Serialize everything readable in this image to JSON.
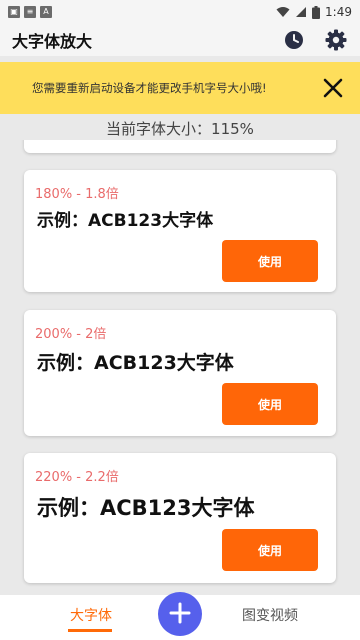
{
  "status_bar": {
    "time": "1:49",
    "left_icons": [
      "image-notification-icon",
      "news-notification-icon",
      "font-a-notification-icon"
    ],
    "right_icons": [
      "wifi-icon",
      "signal-icon",
      "battery-icon"
    ]
  },
  "app_bar": {
    "title": "大字体放大",
    "actions": [
      "history-icon",
      "settings-icon"
    ]
  },
  "notice": {
    "text": "您需要重新启动设备才能更改手机字号大小哦!",
    "close_icon": "close-icon",
    "background": "#fede5b"
  },
  "current_size": {
    "text": "当前字体大小：115%"
  },
  "options": [
    {
      "label": "180% - 1.8倍",
      "sample": "示例：ACB123大字体",
      "button": "使用"
    },
    {
      "label": "200% - 2倍",
      "sample": "示例：ACB123大字体",
      "button": "使用"
    },
    {
      "label": "220% - 2.2倍",
      "sample": "示例：ACB123大字体",
      "button": "使用"
    }
  ],
  "bottom_nav": {
    "left_tab": "大字体",
    "fab_icon": "plus-icon",
    "right_tab": "图变视频"
  },
  "colors": {
    "accent": "#ff6608",
    "label": "#e96b6b",
    "fab": "#5660ec"
  }
}
